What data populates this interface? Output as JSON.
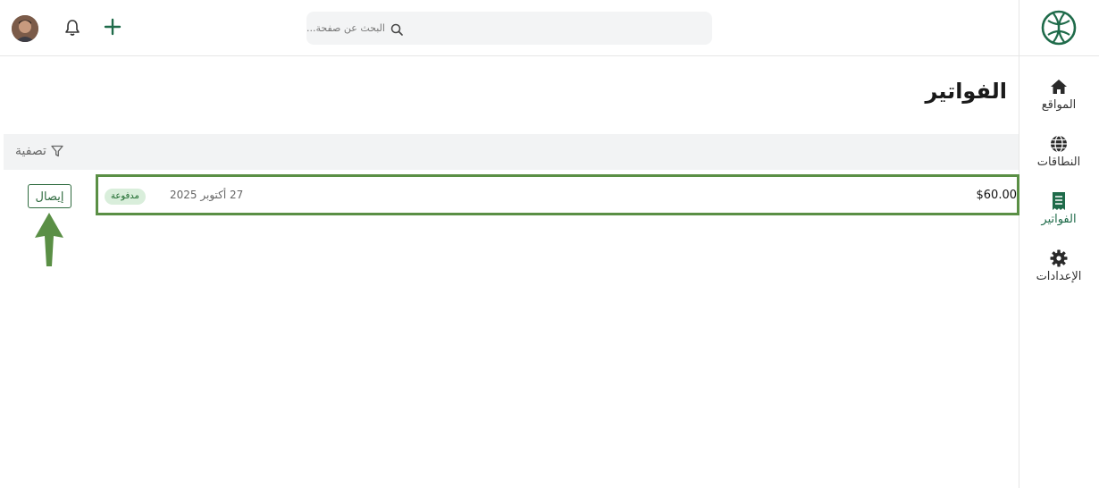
{
  "sidebar": {
    "logo_icon": "globe-leaf-logo",
    "items": [
      {
        "label": "المواقع",
        "icon": "home-icon"
      },
      {
        "label": "النطاقات",
        "icon": "globe-icon"
      },
      {
        "label": "الفواتير",
        "icon": "receipt-icon",
        "active": true
      },
      {
        "label": "الإعدادات",
        "icon": "gear-icon"
      }
    ]
  },
  "topbar": {
    "search_placeholder": "البحث عن صفحة...",
    "avatar": "user-avatar",
    "bell_icon": "bell-icon",
    "plus_icon": "plus-icon"
  },
  "page": {
    "title": "الفواتير"
  },
  "filter": {
    "label": "تصفية",
    "icon": "filter-icon"
  },
  "invoices": [
    {
      "amount": "$60.00",
      "date": "27 أكتوبر 2025",
      "status": "مدفوعة",
      "receipt_label": "إيصال"
    }
  ],
  "colors": {
    "brand": "#1f6b4a",
    "highlight": "#5a8f45",
    "badge_bg": "#d9eedb"
  }
}
